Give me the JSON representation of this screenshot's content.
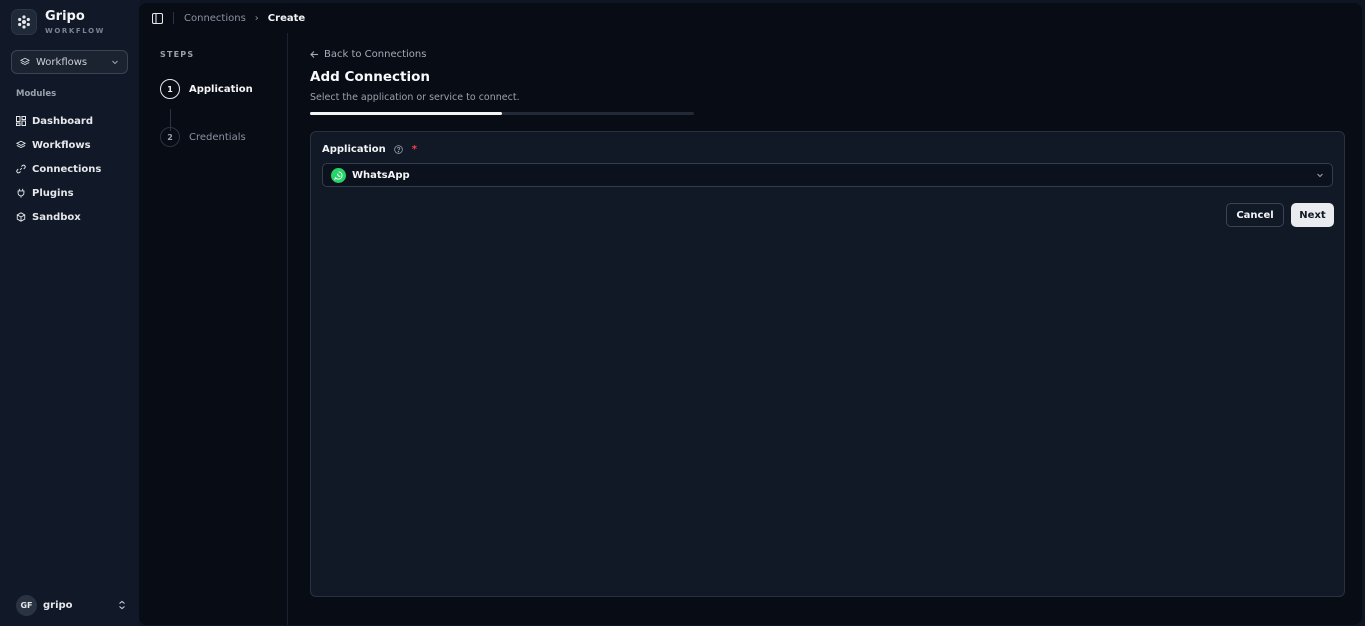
{
  "brand": {
    "name": "Gripo",
    "subtitle": "WORKFLOW"
  },
  "workspace_select": {
    "value": "Workflows"
  },
  "sidebar": {
    "section_label": "Modules",
    "items": [
      {
        "label": "Dashboard",
        "icon": "dashboard-icon"
      },
      {
        "label": "Workflows",
        "icon": "layers-icon"
      },
      {
        "label": "Connections",
        "icon": "link-icon"
      },
      {
        "label": "Plugins",
        "icon": "plug-icon"
      },
      {
        "label": "Sandbox",
        "icon": "box-icon"
      }
    ]
  },
  "user": {
    "initials": "GF",
    "name": "gripo"
  },
  "breadcrumb": {
    "parent": "Connections",
    "current": "Create"
  },
  "steps": {
    "title": "STEPS",
    "items": [
      {
        "number": "1",
        "label": "Application",
        "active": true
      },
      {
        "number": "2",
        "label": "Credentials",
        "active": false
      }
    ]
  },
  "page": {
    "back_label": "Back to Connections",
    "title": "Add Connection",
    "subtitle": "Select the application or service to connect.",
    "progress_fraction": 0.5
  },
  "form": {
    "application_label": "Application",
    "required_marker": "*",
    "application_value": "WhatsApp",
    "cancel_label": "Cancel",
    "next_label": "Next"
  },
  "colors": {
    "accent_green": "#25d366",
    "required_red": "#ef4444"
  }
}
